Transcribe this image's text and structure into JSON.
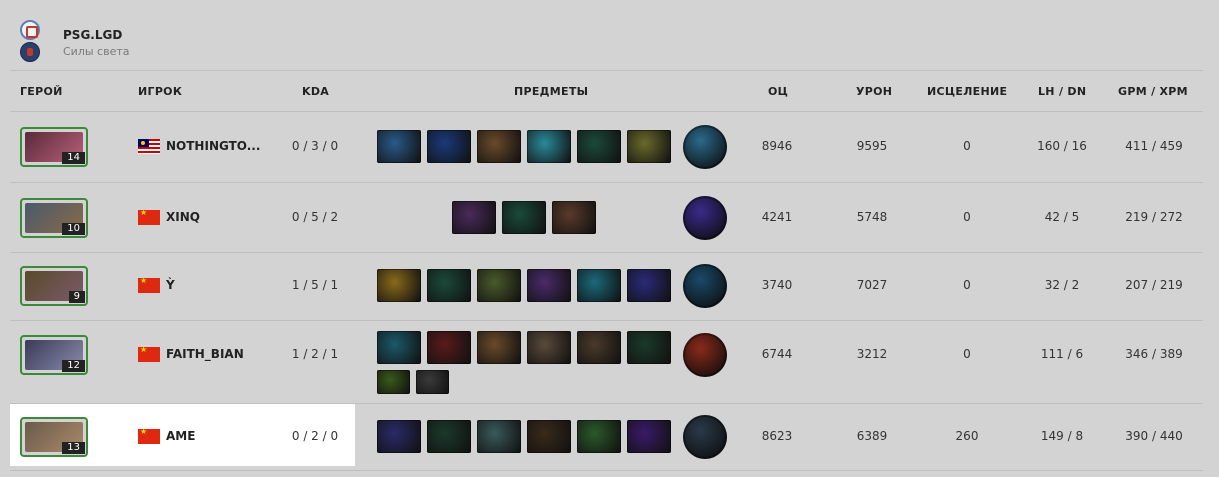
{
  "team": {
    "name": "PSG.LGD",
    "side": "Силы света"
  },
  "columns": {
    "hero": "ГЕРОЙ",
    "player": "ИГРОК",
    "kda": "KDA",
    "items": "ПРЕДМЕТЫ",
    "net_worth": "ОЦ",
    "damage": "УРОН",
    "healing": "ИСЦЕЛЕНИЕ",
    "lh_dn": "LH / DN",
    "gpm_xpm": "GPM / XPM"
  },
  "players": [
    {
      "hero_level": "14",
      "flag": "my",
      "name": "NOTHINGTO...",
      "kda": "0 / 3 / 0",
      "net_worth": "8946",
      "damage": "9595",
      "healing": "0",
      "lh_dn": "160 / 16",
      "gpm_xpm": "411 / 459",
      "hero_colors": [
        "#5a2a3a",
        "#b8607a"
      ],
      "items": [
        "#2a5a8a",
        "#1a3a7a",
        "#6a4a2a",
        "#2a8a9a",
        "#1a4a3a",
        "#6a6a2a"
      ],
      "neutral": "#2a6a8a"
    },
    {
      "hero_level": "10",
      "flag": "cn",
      "name": "XINQ",
      "kda": "0 / 5 / 2",
      "net_worth": "4241",
      "damage": "5748",
      "healing": "0",
      "lh_dn": "42 / 5",
      "gpm_xpm": "219 / 272",
      "hero_colors": [
        "#4a5a6a",
        "#8a6a4a"
      ],
      "items": [
        "#4a2a5a",
        "#1a4a3a",
        "#5a3a2a"
      ],
      "neutral": "#3a2a8a"
    },
    {
      "hero_level": "9",
      "flag": "cn",
      "name": "Ỳ",
      "kda": "1 / 5 / 1",
      "net_worth": "3740",
      "damage": "7027",
      "healing": "0",
      "lh_dn": "32 / 2",
      "gpm_xpm": "207 / 219",
      "hero_colors": [
        "#5a4a2a",
        "#7a5a6a"
      ],
      "items": [
        "#8a6a1a",
        "#1a4a3a",
        "#4a5a2a",
        "#4a2a6a",
        "#1a6a7a",
        "#2a2a7a"
      ],
      "neutral": "#1a4a6a"
    },
    {
      "hero_level": "12",
      "flag": "cn",
      "name": "FAITH_BIAN",
      "kda": "1 / 2 / 1",
      "net_worth": "6744",
      "damage": "3212",
      "healing": "0",
      "lh_dn": "111 / 6",
      "gpm_xpm": "346 / 389",
      "hero_colors": [
        "#3a3a5a",
        "#8a8aaa"
      ],
      "items": [
        "#1a5a6a",
        "#5a1a1a",
        "#6a4a2a",
        "#5a4a3a",
        "#4a3a2a",
        "#1a3a2a"
      ],
      "items_row2": [
        "#3a5a1a",
        "#3a3a3a"
      ],
      "neutral": "#8a2a1a"
    },
    {
      "hero_level": "13",
      "flag": "cn",
      "name": "AME",
      "kda": "0 / 2 / 0",
      "net_worth": "8623",
      "damage": "6389",
      "healing": "260",
      "lh_dn": "149 / 8",
      "gpm_xpm": "390 / 440",
      "hero_colors": [
        "#6a5a4a",
        "#aa8a6a"
      ],
      "items": [
        "#2a2a6a",
        "#1a3a2a",
        "#3a5a5a",
        "#3a2a1a",
        "#2a5a2a",
        "#3a1a6a"
      ],
      "neutral": "#2a3a4a"
    }
  ]
}
